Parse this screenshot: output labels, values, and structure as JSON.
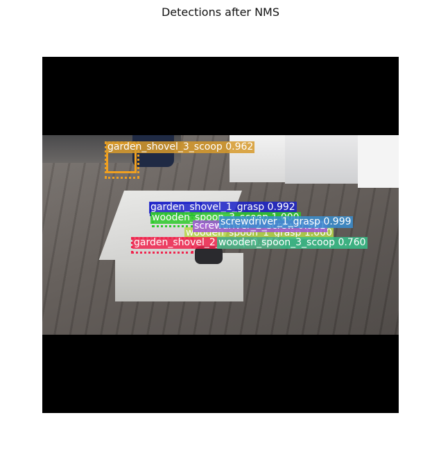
{
  "figure": {
    "title": "Detections after NMS"
  },
  "detections": [
    {
      "label": "garden_shovel_3_scoop 0.962",
      "color": "#d79a2b"
    },
    {
      "label": "garden_shovel_1_grasp 0.992",
      "color": "#1c22c9"
    },
    {
      "label": "wooden_spoon_3_scoop 1.000",
      "color": "#2ec92a"
    },
    {
      "label": "screwdriver_1_grasp 0.999",
      "color": "#3a8ed0"
    },
    {
      "label": "screwdriver_2_screw 0.981",
      "color": "#a056d6"
    },
    {
      "label": "wooden_spoon_1_grasp 1.000",
      "color": "#b7d84a"
    },
    {
      "label": "garden_shovel_2_scoop 0.870",
      "color": "#f0244e"
    },
    {
      "label": "wooden_spoon_3_scoop 0.760",
      "color": "#37c08a"
    }
  ]
}
